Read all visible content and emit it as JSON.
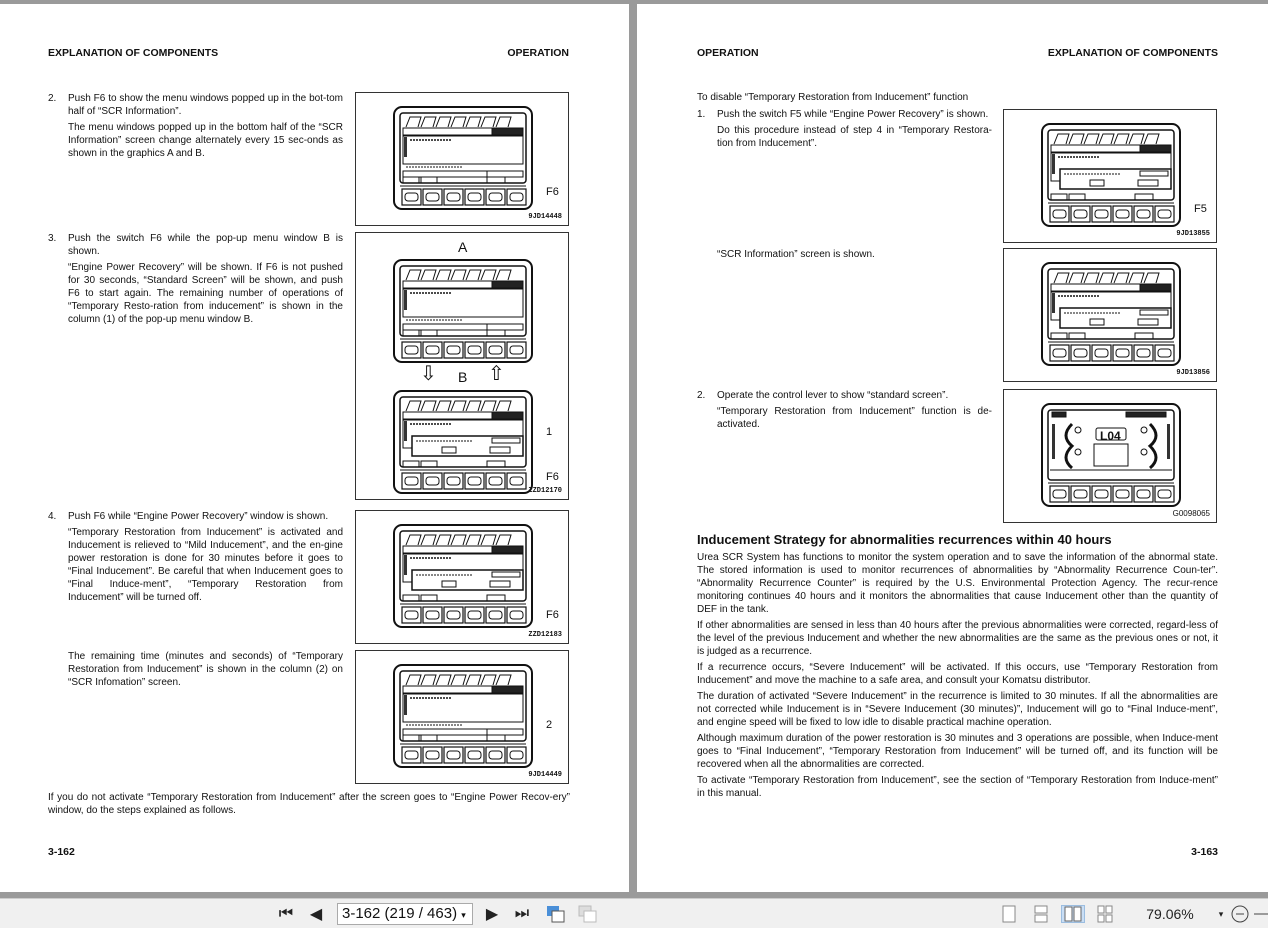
{
  "left_page": {
    "header_left": "EXPLANATION OF COMPONENTS",
    "header_right": "OPERATION",
    "items": [
      {
        "num": "2.",
        "paras": [
          "Push F6 to show the menu windows popped up in the bot-tom half of “SCR Information”.",
          "The menu windows popped up in the bottom half of the “SCR Information” screen change alternately every 15 sec-onds as shown in the graphics A and B."
        ]
      },
      {
        "num": "3.",
        "paras": [
          "Push the switch F6 while the pop-up menu window B is shown.",
          "“Engine Power Recovery” will be shown. If F6 is not pushed for 30 seconds, “Standard Screen” will be shown, and push F6 to start again. The remaining number of operations of “Temporary Resto-ration from inducement” is shown in the column (1) of the pop-up menu window B."
        ]
      },
      {
        "num": "4.",
        "paras": [
          "Push F6 while “Engine Power Recovery” window is shown.",
          "“Temporary Restoration from Inducement” is activated and Inducement is relieved to “Mild Inducement”, and the en-gine power restoration is done for 30 minutes before it goes to “Final Inducement”. Be careful that when Inducement goes to “Final Induce-ment”, “Temporary Restoration from Inducement” will be turned off."
        ]
      }
    ],
    "remaining_text": "The remaining time (minutes and seconds) of “Temporary Restoration from Inducement” is shown in the column (2) on “SCR Infomation” screen.",
    "bottom_text": "If you do not activate “Temporary Restoration from Inducement” after the screen goes to “Engine Power Recov-ery” window, do the steps explained as follows.",
    "footer": "3-162",
    "figures": [
      {
        "id": "9JD14448",
        "callouts": [
          "F6"
        ]
      },
      {
        "id": "ZZD12170",
        "label_a": "A",
        "label_b": "B",
        "callouts": [
          "1",
          "F6"
        ]
      },
      {
        "id": "ZZD12183",
        "callouts": [
          "F6"
        ]
      },
      {
        "id": "9JD14449",
        "callouts": [
          "2"
        ]
      }
    ]
  },
  "right_page": {
    "header_left": "OPERATION",
    "header_right": "EXPLANATION OF COMPONENTS",
    "intro": "To disable “Temporary Restoration from Inducement” function",
    "items": [
      {
        "num": "1.",
        "paras": [
          "Push the switch F5 while “Engine Power Recovery” is shown.",
          "Do this procedure instead of step 4 in “Temporary Restora-tion from Inducement”."
        ]
      },
      {
        "num": "2.",
        "paras": [
          "Operate the control lever to show “standard screen”.",
          "“Temporary Restoration from Inducement” function is de-activated."
        ]
      }
    ],
    "scr_shown": "“SCR Information” screen is shown.",
    "section_title": "Inducement Strategy for abnormalities recurrences within 40 hours",
    "section_paras": [
      "Urea SCR System has functions to monitor the system operation and to save the information of the abnormal state. The stored information is used to monitor recurrences of abnormalities by “Abnormality Recurrence Coun-ter”. “Abnormality Recurrence Counter” is required by the U.S. Environmental Protection Agency. The recur-rence monitoring continues 40 hours and it monitors the abnormalities that cause Inducement other than the quantity of DEF in the tank.",
      "If other abnormalities are sensed in less than 40 hours after the previous abnormalities were corrected, regard-less of the level of the previous Inducement and whether the new abnormalities are the same as the previous ones or not, it is judged as a recurrence.",
      "If a recurrence occurs, “Severe Inducement” will be activated. If this occurs, use “Temporary Restoration from Inducement” and move the machine to a safe area, and consult your Komatsu distributor.",
      "The duration of activated “Severe Inducement” in the recurrence is limited to 30 minutes. If all the abnormalities are not corrected while Inducement is in “Severe Inducement (30 minutes)”, Inducement will go to “Final Induce-ment”, and engine speed will be fixed to low idle to disable practical machine operation.",
      "Although maximum duration of the power restoration is 30 minutes and 3 operations are possible, when Induce-ment goes to “Final Inducement”, “Temporary Restoration from Inducement” will be turned off, and its function will be recovered when all the abnormalities are corrected.",
      "To activate “Temporary Restoration from Inducement”, see the section of “Temporary Restoration from Induce-ment” in this manual."
    ],
    "footer": "3-163",
    "figures": [
      {
        "id": "9JD13855",
        "callouts": [
          "F5"
        ]
      },
      {
        "id": "9JD13856"
      },
      {
        "id": "G0098065",
        "screen_label": "L04"
      }
    ]
  },
  "toolbar": {
    "page_display": "3-162 (219 / 463)",
    "zoom": "79.06%",
    "active_view": "two-page"
  }
}
